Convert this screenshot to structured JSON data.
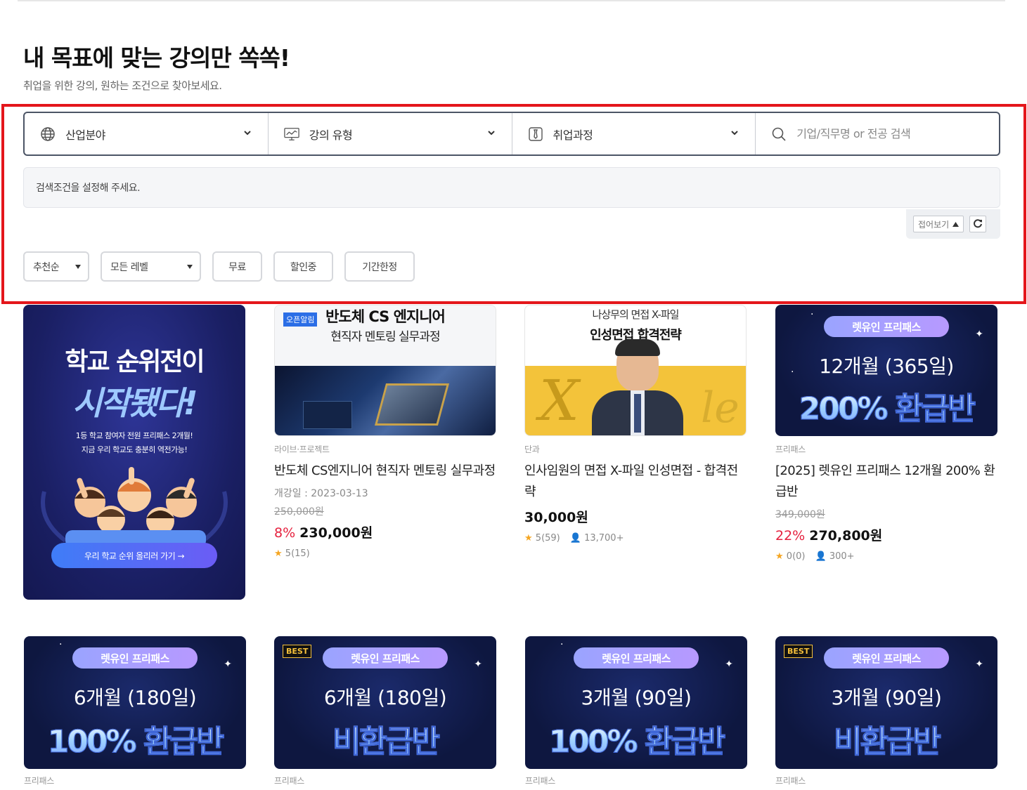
{
  "header": {
    "title": "내 목표에 맞는 강의만 쏙쏙!",
    "subtitle": "취업을 위한 강의, 원하는 조건으로 찾아보세요."
  },
  "filters": {
    "industry": "산업분야",
    "lecture_type": "강의 유형",
    "course": "취업과정",
    "search_placeholder": "기업/직무명 or 전공 검색",
    "condition_message": "검색조건을 설정해 주세요.",
    "fold_label": "접어보기",
    "sort": "추천순",
    "level": "모든 레벨",
    "tags": [
      "무료",
      "할인중",
      "기간한정"
    ]
  },
  "cards": [
    {
      "banner_line1": "학교 순위전이",
      "banner_line2": "시작됐다!",
      "banner_desc1": "1등 학교 참여자 전원 프리패스 2개월!",
      "banner_desc2": "지금 우리 학교도 충분히 역전가능!",
      "banner_button": "우리 학교 순위 올리러 가기 →"
    },
    {
      "thumb_badge": "오픈알림",
      "thumb_line1": "반도체 CS 엔지니어",
      "thumb_line2": "현직자 멘토링 실무과정",
      "category": "라이브·프로젝트",
      "title": "반도체 CS엔지니어 현직자 멘토링 실무과정",
      "date": "개강일 : 2023-03-13",
      "original_price": "250,000원",
      "discount": "8%",
      "price": "230,000원",
      "rating": "5(15)"
    },
    {
      "thumb_line1": "나상무의 면접 X-파일",
      "thumb_line2": "인성면접 합격전략",
      "category": "단과",
      "title": "인사임원의 면접 X-파일 인성면접 - 합격전략",
      "price": "30,000원",
      "rating": "5(59)",
      "students": "13,700+"
    },
    {
      "promo_tag": "렛유인 프리패스",
      "promo_period": "12개월 (365일)",
      "promo_big": "200% 환급반",
      "category": "프리패스",
      "title": "[2025] 렛유인 프리패스 12개월 200% 환급반",
      "original_price": "349,000원",
      "discount": "22%",
      "price": "270,800원",
      "rating": "0(0)",
      "students": "300+"
    }
  ],
  "row2": [
    {
      "best": "",
      "promo_tag": "렛유인 프리패스",
      "promo_period": "6개월 (180일)",
      "promo_big": "100% 환급반",
      "category": "프리패스"
    },
    {
      "best": "BEST",
      "promo_tag": "렛유인 프리패스",
      "promo_period": "6개월 (180일)",
      "promo_big": "비환급반",
      "category": "프리패스"
    },
    {
      "best": "",
      "promo_tag": "렛유인 프리패스",
      "promo_period": "3개월 (90일)",
      "promo_big": "100% 환급반",
      "category": "프리패스"
    },
    {
      "best": "BEST",
      "promo_tag": "렛유인 프리패스",
      "promo_period": "3개월 (90일)",
      "promo_big": "비환급반",
      "category": "프리패스"
    }
  ],
  "colors": {
    "highlight": "#e4161b",
    "discount": "#e5213e",
    "promo_bg": "#0e1740",
    "star": "#f5a623"
  }
}
